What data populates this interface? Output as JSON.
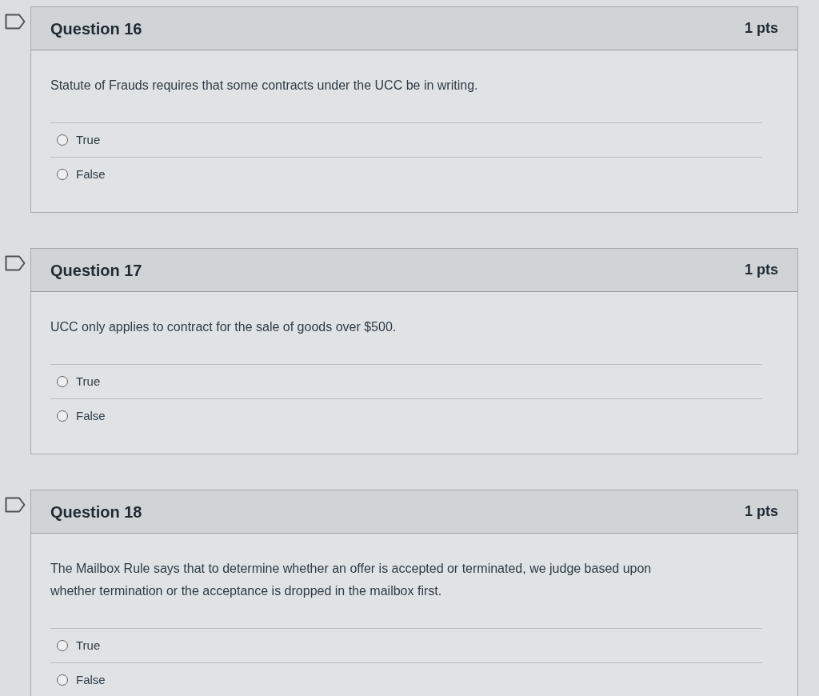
{
  "questions": [
    {
      "title": "Question 16",
      "points": "1 pts",
      "flagged": false,
      "text": "Statute of Frauds requires that some contracts under the UCC be in writing.",
      "answers": [
        {
          "label": "True",
          "selected": false
        },
        {
          "label": "False",
          "selected": false
        }
      ]
    },
    {
      "title": "Question 17",
      "points": "1 pts",
      "flagged": false,
      "text": "UCC only applies to contract for the sale of goods over $500.",
      "answers": [
        {
          "label": "True",
          "selected": false
        },
        {
          "label": "False",
          "selected": false
        }
      ]
    },
    {
      "title": "Question 18",
      "points": "1 pts",
      "flagged": false,
      "text": "The Mailbox Rule says that to determine whether an offer is accepted or terminated, we judge based upon whether termination or the acceptance is dropped in the mailbox first.",
      "answers": [
        {
          "label": "True",
          "selected": false
        },
        {
          "label": "False",
          "selected": false
        }
      ]
    }
  ]
}
